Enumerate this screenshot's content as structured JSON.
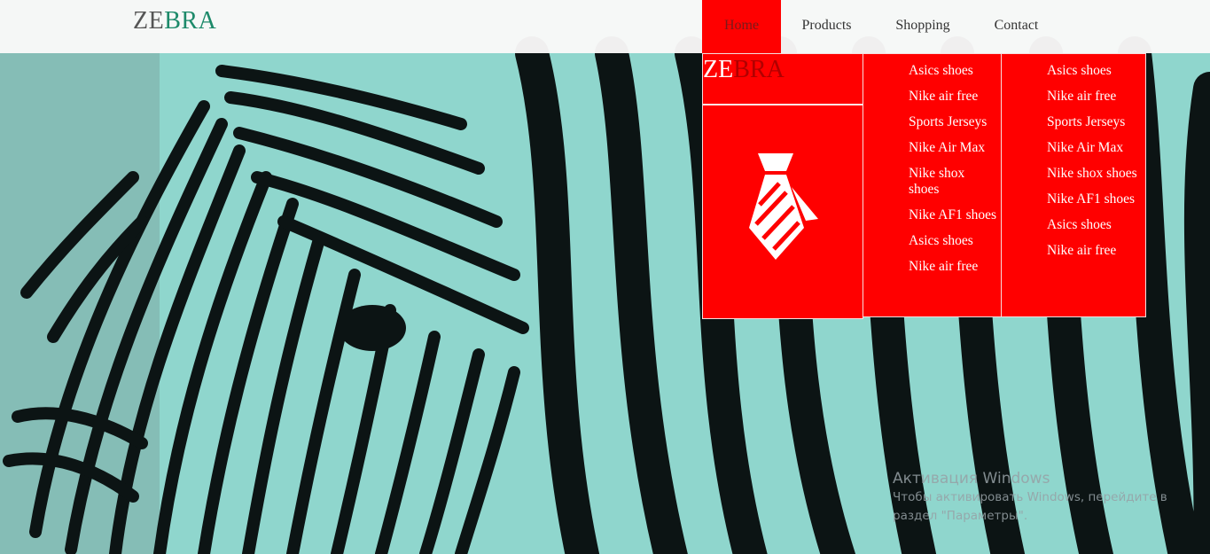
{
  "brand": {
    "part1": "ZE",
    "part2": "BRA"
  },
  "nav": {
    "items": [
      {
        "label": "Home",
        "active": true
      },
      {
        "label": "Products",
        "active": false
      },
      {
        "label": "Shopping",
        "active": false
      },
      {
        "label": "Contact",
        "active": false
      }
    ]
  },
  "dropdown": {
    "brand": {
      "part1": "ZE",
      "part2": "BRA"
    },
    "icon": "necktie-icon",
    "column_a": [
      "Asics shoes",
      "Nike air free",
      "Sports Jerseys",
      "Nike Air Max",
      "Nike shox shoes",
      "Nike AF1 shoes",
      "Asics shoes",
      "Nike air free"
    ],
    "column_b": [
      "Asics shoes",
      "Nike air free",
      "Sports Jerseys",
      "Nike Air Max",
      "Nike shox shoes",
      "Nike AF1 shoes",
      "Asics shoes",
      "Nike air free"
    ]
  },
  "watermark": {
    "title": "Активация Windows",
    "text": "Чтобы активировать Windows, перейдите в раздел \"Параметры\"."
  },
  "colors": {
    "accent_red": "#ff0000",
    "brand_green": "#1d8a6a",
    "zebra_tint": "#8fd6cd"
  }
}
